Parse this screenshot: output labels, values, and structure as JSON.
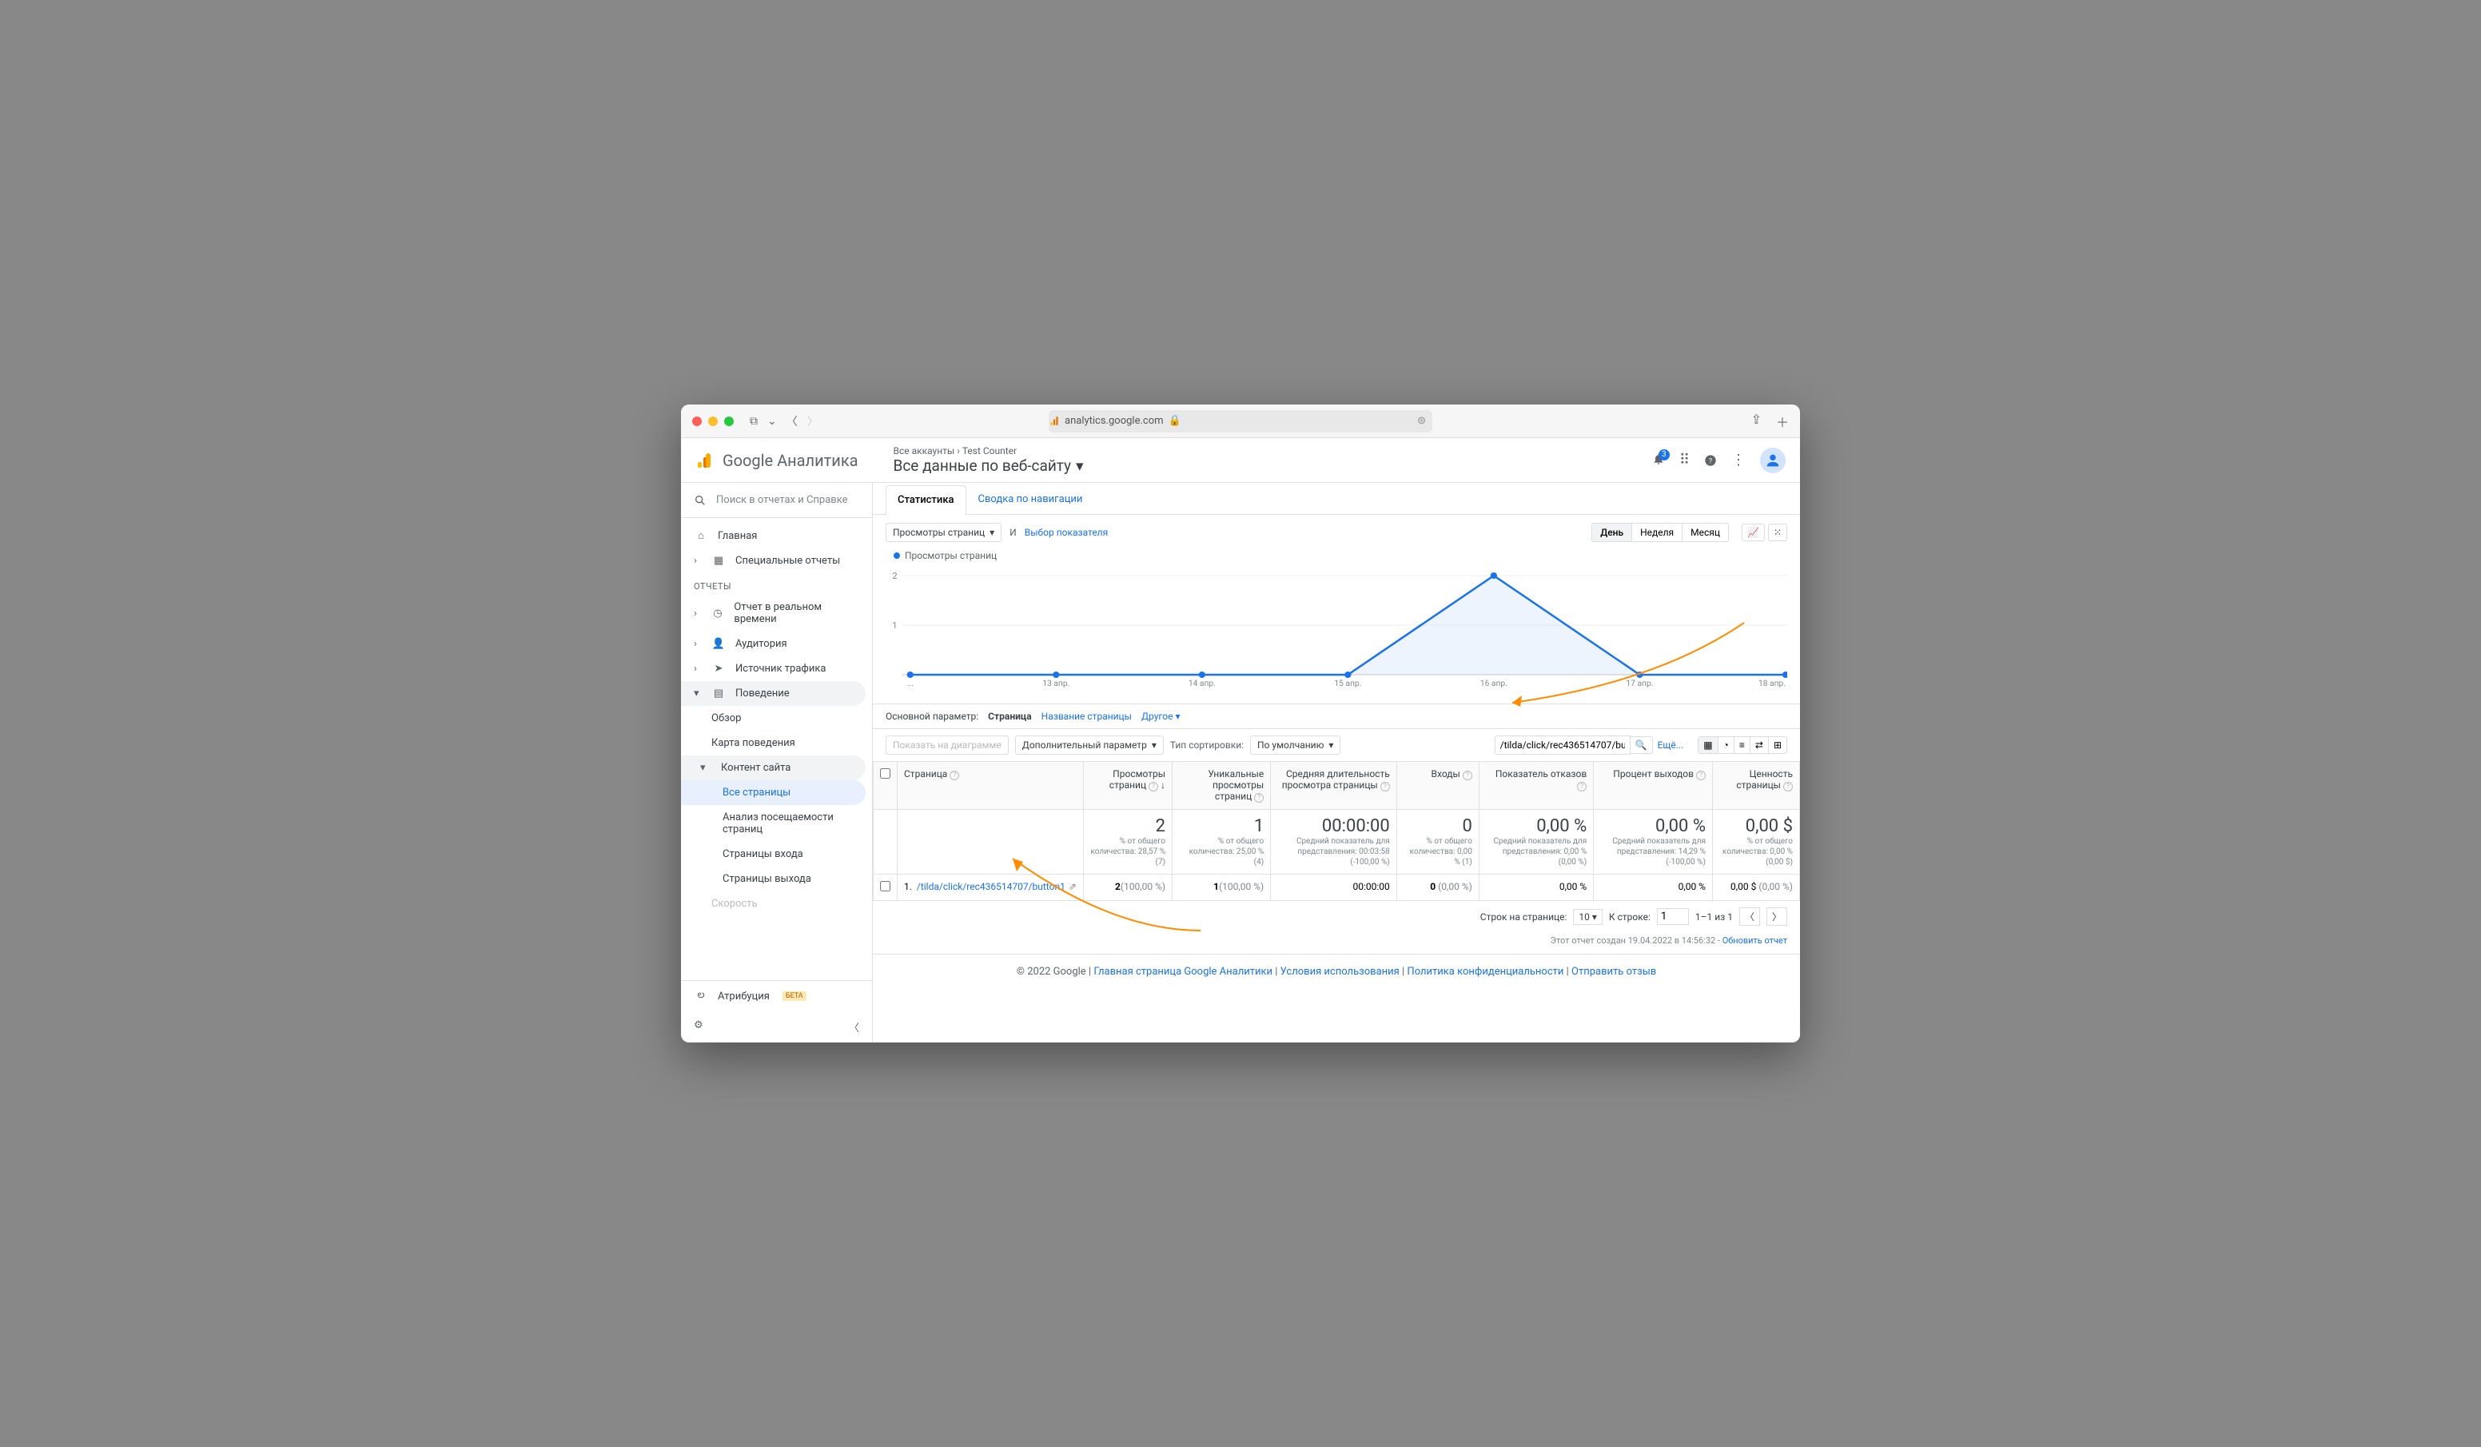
{
  "browser": {
    "url": "analytics.google.com"
  },
  "header": {
    "product": "Google Аналитика",
    "breadcrumb_all": "Все аккаунты",
    "breadcrumb_counter": "Test Counter",
    "view": "Все данные по веб-сайту",
    "notification_count": "3"
  },
  "sidebar": {
    "search_placeholder": "Поиск в отчетах и Справке",
    "home": "Главная",
    "custom": "Специальные отчеты",
    "section": "Отчеты",
    "realtime": "Отчет в реальном времени",
    "audience": "Аудитория",
    "acquisition": "Источник трафика",
    "behavior": "Поведение",
    "overview": "Обзор",
    "behavior_map": "Карта поведения",
    "site_content": "Контент сайта",
    "all_pages": "Все страницы",
    "content_drilldown": "Анализ посещаемости страниц",
    "landing": "Страницы входа",
    "exit": "Страницы выхода",
    "speed": "Скорость",
    "attribution": "Атрибуция",
    "beta": "БЕТА"
  },
  "tabs": {
    "stats": "Статистика",
    "nav": "Сводка по навигации"
  },
  "chart_controls": {
    "metric": "Просмотры страниц",
    "vs": "И",
    "select_metric": "Выбор показателя",
    "day": "День",
    "week": "Неделя",
    "month": "Месяц"
  },
  "chart_data": {
    "type": "line",
    "title": "Просмотры страниц",
    "ylabel": "",
    "xlabel": "",
    "ylim": [
      0,
      2
    ],
    "yticks": [
      1,
      2
    ],
    "categories": [
      "...",
      "13 апр.",
      "14 апр.",
      "15 апр.",
      "16 апр.",
      "17 апр.",
      "18 апр."
    ],
    "series": [
      {
        "name": "Просмотры страниц",
        "values": [
          0,
          0,
          0,
          0,
          2,
          0,
          0
        ],
        "color": "#1a73e8"
      }
    ]
  },
  "dimensions": {
    "label": "Основной параметр:",
    "page": "Страница",
    "page_title": "Название страницы",
    "other": "Другое"
  },
  "filters": {
    "show_on_chart": "Показать на диаграмме",
    "secondary": "Дополнительный параметр",
    "sort_label": "Тип сортировки:",
    "sort_value": "По умолчанию",
    "search_value": "/tilda/click/rec436514707/bu",
    "advanced": "Ещё..."
  },
  "table": {
    "headers": {
      "page": "Страница",
      "pageviews": "Просмотры страниц",
      "unique": "Уникальные просмотры страниц",
      "avg_time": "Средняя длительность просмотра страницы",
      "entrances": "Входы",
      "bounce": "Показатель отказов",
      "exit_pct": "Процент выходов",
      "value": "Ценность страницы"
    },
    "summary": {
      "pageviews": "2",
      "pageviews_sub": "% от общего количества: 28,57 % (7)",
      "unique": "1",
      "unique_sub": "% от общего количества: 25,00 % (4)",
      "avg_time": "00:00:00",
      "avg_time_sub": "Средний показатель для представления: 00:03:58 (-100,00 %)",
      "entrances": "0",
      "entrances_sub": "% от общего количества: 0,00 % (1)",
      "bounce": "0,00 %",
      "bounce_sub": "Средний показатель для представления: 0,00 % (0,00 %)",
      "exit_pct": "0,00 %",
      "exit_pct_sub": "Средний показатель для представления: 14,29 % (-100,00 %)",
      "value": "0,00 $",
      "value_sub": "% от общего количества: 0,00 % (0,00 $)"
    },
    "rows": [
      {
        "idx": "1.",
        "page": "/tilda/click/rec436514707/button1",
        "pageviews": "2",
        "pageviews_pct": "(100,00 %)",
        "unique": "1",
        "unique_pct": "(100,00 %)",
        "avg_time": "00:00:00",
        "entrances": "0",
        "entrances_pct": "(0,00 %)",
        "bounce": "0,00 %",
        "exit_pct": "0,00 %",
        "value": "0,00 $",
        "value_pct": "(0,00 %)"
      }
    ]
  },
  "pager": {
    "rows_label": "Строк на странице:",
    "rows_value": "10",
    "goto_label": "К строке:",
    "goto_value": "1",
    "range": "1–1 из 1"
  },
  "report_ts": {
    "text": "Этот отчет создан 19.04.2022 в 14:56:32",
    "refresh": "Обновить отчет"
  },
  "footer": {
    "copy": "© 2022 Google",
    "home": "Главная страница Google Аналитики",
    "terms": "Условия использования",
    "privacy": "Политика конфиденциальности",
    "feedback": "Отправить отзыв"
  }
}
